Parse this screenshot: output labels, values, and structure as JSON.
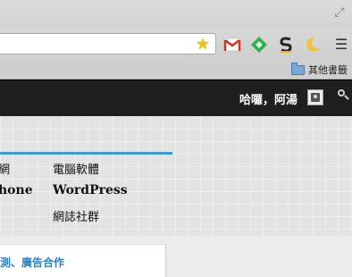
{
  "browser": {
    "icons": {
      "fullscreen": "fullscreen-icon",
      "bookmark_star": "star-icon",
      "gmail": "gmail-icon",
      "feedly": "feedly-icon",
      "s_extension": "s-extension-icon",
      "moon": "moon-icon",
      "menu": "menu-icon",
      "folder": "folder-icon"
    },
    "star_color": "#f4c20d",
    "bookmarks_bar": {
      "other_bookmarks_label": "其他書籤"
    }
  },
  "site_header": {
    "greeting": "哈囉，阿湯",
    "avatar_icon": "avatar",
    "search_icon": "search-icon",
    "bar_color": "#1f1f1f"
  },
  "menu": {
    "accent_color": "#3c9ad6",
    "left_column": [
      "網",
      "hone"
    ],
    "right_column": [
      "電腦軟體",
      "WordPress",
      "網誌社群"
    ]
  },
  "content": {
    "card_link": "測、廣告合作",
    "link_color": "#2f7fbf"
  }
}
